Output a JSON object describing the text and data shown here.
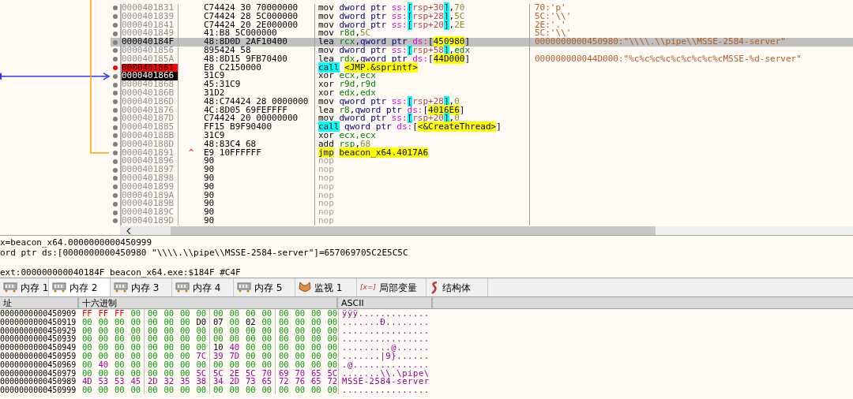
{
  "disasm": {
    "rows": [
      {
        "address": "0000401831",
        "bytes": "C74424 30 70000000",
        "breakpoint": false,
        "current": false,
        "selected": false,
        "comment": "70:'p'",
        "instruction": [
          {
            "text": "mov ",
            "kind": "op"
          },
          {
            "text": "dword ptr ",
            "kind": "ptr"
          },
          {
            "text": "ss:",
            "kind": "seg"
          },
          {
            "text": "[",
            "kind": "sbr"
          },
          {
            "text": "rsp+30",
            "kind": "mem"
          },
          {
            "text": "]",
            "kind": "sbr"
          },
          {
            "text": ",",
            "kind": "punct"
          },
          {
            "text": "70",
            "kind": "num"
          }
        ]
      },
      {
        "address": "0000401839",
        "bytes": "C74424 28 5C000000",
        "breakpoint": false,
        "current": false,
        "selected": false,
        "comment": "5C:'\\\\'",
        "instruction": [
          {
            "text": "mov ",
            "kind": "op"
          },
          {
            "text": "dword ptr ",
            "kind": "ptr"
          },
          {
            "text": "ss:",
            "kind": "seg"
          },
          {
            "text": "[",
            "kind": "sbr"
          },
          {
            "text": "rsp+28",
            "kind": "mem"
          },
          {
            "text": "]",
            "kind": "sbr"
          },
          {
            "text": ",",
            "kind": "punct"
          },
          {
            "text": "5C",
            "kind": "num"
          }
        ]
      },
      {
        "address": "0000401841",
        "bytes": "C74424 20 2E000000",
        "breakpoint": false,
        "current": false,
        "selected": false,
        "comment": "2E:'.'",
        "instruction": [
          {
            "text": "mov ",
            "kind": "op"
          },
          {
            "text": "dword ptr ",
            "kind": "ptr"
          },
          {
            "text": "ss:",
            "kind": "seg"
          },
          {
            "text": "[",
            "kind": "sbr"
          },
          {
            "text": "rsp+20",
            "kind": "mem"
          },
          {
            "text": "]",
            "kind": "sbr"
          },
          {
            "text": ",",
            "kind": "punct"
          },
          {
            "text": "2E",
            "kind": "num"
          }
        ]
      },
      {
        "address": "0000401849",
        "bytes": "41:B8 5C000000",
        "breakpoint": false,
        "current": false,
        "selected": false,
        "comment": "5C:'\\\\'",
        "instruction": [
          {
            "text": "mov ",
            "kind": "op"
          },
          {
            "text": "r8d",
            "kind": "reg"
          },
          {
            "text": ",",
            "kind": "punct"
          },
          {
            "text": "5C",
            "kind": "num"
          }
        ]
      },
      {
        "address": "000040184F",
        "bytes": "48:8D0D 2AF10400",
        "breakpoint": false,
        "current": false,
        "selected": true,
        "comment": "0000000000450980:\"\\\\\\\\.\\\\pipe\\\\MSSE-2584-server\"",
        "instruction": [
          {
            "text": "lea ",
            "kind": "op"
          },
          {
            "text": "rcx",
            "kind": "reg"
          },
          {
            "text": ",",
            "kind": "punct"
          },
          {
            "text": "qword ptr ",
            "kind": "ptr"
          },
          {
            "text": "ds:",
            "kind": "seg"
          },
          {
            "text": "[",
            "kind": "punct"
          },
          {
            "text": "450980",
            "kind": "addr"
          },
          {
            "text": "]",
            "kind": "punct"
          }
        ]
      },
      {
        "address": "0000401856",
        "bytes": "895424 58",
        "breakpoint": false,
        "current": false,
        "selected": false,
        "instruction": [
          {
            "text": "mov ",
            "kind": "op"
          },
          {
            "text": "dword ptr ",
            "kind": "ptr"
          },
          {
            "text": "ss:",
            "kind": "seg"
          },
          {
            "text": "[",
            "kind": "sbr"
          },
          {
            "text": "rsp+58",
            "kind": "mem"
          },
          {
            "text": "]",
            "kind": "sbr"
          },
          {
            "text": ",",
            "kind": "punct"
          },
          {
            "text": "edx",
            "kind": "reg"
          }
        ]
      },
      {
        "address": "000040185A",
        "bytes": "48:8D15 9FB70400",
        "breakpoint": false,
        "current": false,
        "selected": false,
        "comment": "000000000044D000:\"%c%c%c%c%c%c%c%c%cMSSE-%d-server\"",
        "instruction": [
          {
            "text": "lea ",
            "kind": "op"
          },
          {
            "text": "rdx",
            "kind": "reg"
          },
          {
            "text": ",",
            "kind": "punct"
          },
          {
            "text": "qword ptr ",
            "kind": "ptr"
          },
          {
            "text": "ds:",
            "kind": "seg"
          },
          {
            "text": "[",
            "kind": "punct"
          },
          {
            "text": "44D000",
            "kind": "addr"
          },
          {
            "text": "]",
            "kind": "punct"
          }
        ]
      },
      {
        "address": "0000401861",
        "bytes": "E8 C2150000",
        "breakpoint": true,
        "current": false,
        "selected": false,
        "instruction": [
          {
            "text": "call",
            "kind": "call"
          },
          {
            "text": "<JMP.&sprintf>",
            "kind": "addr"
          }
        ]
      },
      {
        "address": "0000401866",
        "bytes": "31C9",
        "breakpoint": false,
        "current": true,
        "selected": false,
        "instruction": [
          {
            "text": "xor ",
            "kind": "op"
          },
          {
            "text": "ecx,ecx",
            "kind": "reg"
          }
        ]
      },
      {
        "address": "0000401868",
        "bytes": "45:31C9",
        "breakpoint": false,
        "current": false,
        "selected": false,
        "instruction": [
          {
            "text": "xor ",
            "kind": "op"
          },
          {
            "text": "r9d,r9d",
            "kind": "reg"
          }
        ]
      },
      {
        "address": "000040186B",
        "bytes": "31D2",
        "breakpoint": false,
        "current": false,
        "selected": false,
        "instruction": [
          {
            "text": "xor ",
            "kind": "op"
          },
          {
            "text": "edx,edx",
            "kind": "reg"
          }
        ]
      },
      {
        "address": "000040186D",
        "bytes": "48:C74424 28 0000000",
        "breakpoint": false,
        "current": false,
        "selected": false,
        "instruction": [
          {
            "text": "mov ",
            "kind": "op"
          },
          {
            "text": "qword ptr ",
            "kind": "ptr"
          },
          {
            "text": "ss:",
            "kind": "seg"
          },
          {
            "text": "[",
            "kind": "sbr"
          },
          {
            "text": "rsp+28",
            "kind": "mem"
          },
          {
            "text": "]",
            "kind": "sbr"
          },
          {
            "text": ",",
            "kind": "punct"
          },
          {
            "text": "0",
            "kind": "num"
          }
        ]
      },
      {
        "address": "0000401876",
        "bytes": "4C:8D05 69FEFFFF",
        "breakpoint": false,
        "current": false,
        "selected": false,
        "instruction": [
          {
            "text": "lea ",
            "kind": "op"
          },
          {
            "text": "r8",
            "kind": "reg"
          },
          {
            "text": ",",
            "kind": "punct"
          },
          {
            "text": "qword ptr ",
            "kind": "ptr"
          },
          {
            "text": "ds:",
            "kind": "seg"
          },
          {
            "text": "[",
            "kind": "punct"
          },
          {
            "text": "4016E6",
            "kind": "addr"
          },
          {
            "text": "]",
            "kind": "punct"
          }
        ]
      },
      {
        "address": "000040187D",
        "bytes": "C74424 20 00000000",
        "breakpoint": false,
        "current": false,
        "selected": false,
        "instruction": [
          {
            "text": "mov ",
            "kind": "op"
          },
          {
            "text": "dword ptr ",
            "kind": "ptr"
          },
          {
            "text": "ss:",
            "kind": "seg"
          },
          {
            "text": "[",
            "kind": "sbr"
          },
          {
            "text": "rsp+20",
            "kind": "mem"
          },
          {
            "text": "]",
            "kind": "sbr"
          },
          {
            "text": ",",
            "kind": "punct"
          },
          {
            "text": "0",
            "kind": "num"
          }
        ]
      },
      {
        "address": "0000401885",
        "bytes": "FF15 B9F90400",
        "breakpoint": false,
        "current": false,
        "selected": false,
        "instruction": [
          {
            "text": "call",
            "kind": "call"
          },
          {
            "text": "qword ptr ",
            "kind": "ptr"
          },
          {
            "text": "ds:",
            "kind": "seg"
          },
          {
            "text": "[",
            "kind": "punct"
          },
          {
            "text": "<&CreateThread>",
            "kind": "addr"
          },
          {
            "text": "]",
            "kind": "punct"
          }
        ]
      },
      {
        "address": "000040188B",
        "bytes": "31C9",
        "breakpoint": false,
        "current": false,
        "selected": false,
        "instruction": [
          {
            "text": "xor ",
            "kind": "op"
          },
          {
            "text": "ecx,ecx",
            "kind": "reg"
          }
        ]
      },
      {
        "address": "000040188D",
        "bytes": "48:83C4 68",
        "breakpoint": false,
        "current": false,
        "selected": false,
        "instruction": [
          {
            "text": "add ",
            "kind": "op"
          },
          {
            "text": "rsp",
            "kind": "reg"
          },
          {
            "text": ",",
            "kind": "punct"
          },
          {
            "text": "68",
            "kind": "num"
          }
        ]
      },
      {
        "address": "0000401891",
        "bytes": "E9 10FFFFFF",
        "marker": "^",
        "breakpoint": false,
        "current": false,
        "selected": false,
        "instruction": [
          {
            "text": "jmp",
            "kind": "jmp"
          },
          {
            "text": "beacon_x64.4017A6",
            "kind": "addr"
          }
        ]
      },
      {
        "address": "0000401896",
        "bytes": "90",
        "breakpoint": false,
        "current": false,
        "selected": false,
        "instruction": [
          {
            "text": "nop",
            "kind": "nop"
          }
        ]
      },
      {
        "address": "0000401897",
        "bytes": "90",
        "breakpoint": false,
        "current": false,
        "selected": false,
        "instruction": [
          {
            "text": "nop",
            "kind": "nop"
          }
        ]
      },
      {
        "address": "0000401898",
        "bytes": "90",
        "breakpoint": false,
        "current": false,
        "selected": false,
        "instruction": [
          {
            "text": "nop",
            "kind": "nop"
          }
        ]
      },
      {
        "address": "0000401899",
        "bytes": "90",
        "breakpoint": false,
        "current": false,
        "selected": false,
        "instruction": [
          {
            "text": "nop",
            "kind": "nop"
          }
        ]
      },
      {
        "address": "000040189A",
        "bytes": "90",
        "breakpoint": false,
        "current": false,
        "selected": false,
        "instruction": [
          {
            "text": "nop",
            "kind": "nop"
          }
        ]
      },
      {
        "address": "000040189B",
        "bytes": "90",
        "breakpoint": false,
        "current": false,
        "selected": false,
        "instruction": [
          {
            "text": "nop",
            "kind": "nop"
          }
        ]
      },
      {
        "address": "000040189C",
        "bytes": "90",
        "breakpoint": false,
        "current": false,
        "selected": false,
        "instruction": [
          {
            "text": "nop",
            "kind": "nop"
          }
        ]
      },
      {
        "address": "000040189D",
        "bytes": "90",
        "breakpoint": false,
        "current": false,
        "selected": false,
        "instruction": [
          {
            "text": "nop",
            "kind": "nop"
          }
        ]
      }
    ]
  },
  "info": {
    "lines": [
      "x=beacon_x64.0000000000450999",
      "ord ptr ds:[0000000000450980 \"\\\\\\\\.\\\\pipe\\\\MSSE-2584-server\"]=657069705C2E5C5C"
    ],
    "location": "ext:000000000040184F beacon_x64.exe:$184F #C4F"
  },
  "tabs": [
    {
      "label": "内存 1",
      "kind": "memory",
      "selected": false
    },
    {
      "label": "内存 2",
      "kind": "memory",
      "selected": true
    },
    {
      "label": "内存 3",
      "kind": "memory",
      "selected": false
    },
    {
      "label": "内存 4",
      "kind": "memory",
      "selected": false
    },
    {
      "label": "内存 5",
      "kind": "memory",
      "selected": false
    },
    {
      "label": "监视 1",
      "kind": "watch",
      "selected": false
    },
    {
      "label": "局部变量",
      "kind": "locals",
      "icon_text": "[x=]",
      "selected": false
    },
    {
      "label": "结构体",
      "kind": "struct",
      "selected": false
    }
  ],
  "dump": {
    "columns": [
      "址",
      "十六进制",
      "ASCII"
    ],
    "rows": [
      {
        "address": "0000000000450909",
        "bytes": [
          "FF",
          "FF",
          "FF",
          "00",
          "00",
          "00",
          "00",
          "00",
          "00",
          "00",
          "00",
          "00",
          "00",
          "00",
          "00",
          "00"
        ],
        "ascii": "ÿÿÿ............."
      },
      {
        "address": "0000000000450919",
        "bytes": [
          "00",
          "00",
          "00",
          "00",
          "00",
          "00",
          "00",
          "D0",
          "07",
          "00",
          "02",
          "00",
          "00",
          "00",
          "00",
          "00"
        ],
        "ascii": ".......Ð........"
      },
      {
        "address": "0000000000450929",
        "bytes": [
          "00",
          "00",
          "00",
          "00",
          "00",
          "00",
          "00",
          "00",
          "00",
          "00",
          "00",
          "00",
          "00",
          "00",
          "00",
          "00"
        ],
        "ascii": "................"
      },
      {
        "address": "0000000000450939",
        "bytes": [
          "00",
          "00",
          "00",
          "00",
          "00",
          "00",
          "00",
          "00",
          "00",
          "00",
          "00",
          "00",
          "00",
          "00",
          "00",
          "00"
        ],
        "ascii": "................"
      },
      {
        "address": "0000000000450949",
        "bytes": [
          "00",
          "00",
          "00",
          "00",
          "00",
          "00",
          "00",
          "00",
          "10",
          "40",
          "00",
          "00",
          "00",
          "00",
          "00",
          "00"
        ],
        "ascii": ".........@......"
      },
      {
        "address": "0000000000450959",
        "bytes": [
          "00",
          "00",
          "00",
          "00",
          "00",
          "00",
          "00",
          "7C",
          "39",
          "7D",
          "00",
          "00",
          "00",
          "00",
          "00",
          "00"
        ],
        "ascii": ".......|9}......"
      },
      {
        "address": "0000000000450969",
        "bytes": [
          "00",
          "40",
          "00",
          "00",
          "00",
          "00",
          "00",
          "00",
          "00",
          "00",
          "00",
          "00",
          "00",
          "00",
          "00",
          "00"
        ],
        "ascii": ".@.............."
      },
      {
        "address": "0000000000450979",
        "bytes": [
          "00",
          "00",
          "00",
          "00",
          "00",
          "00",
          "00",
          "5C",
          "5C",
          "2E",
          "5C",
          "70",
          "69",
          "70",
          "65",
          "5C"
        ],
        "ascii": ".......\\\\.\\pipe\\"
      },
      {
        "address": "0000000000450989",
        "bytes": [
          "4D",
          "53",
          "53",
          "45",
          "2D",
          "32",
          "35",
          "38",
          "34",
          "2D",
          "73",
          "65",
          "72",
          "76",
          "65",
          "72"
        ],
        "ascii": "MSSE-2584-server"
      },
      {
        "address": "0000000000450999",
        "bytes": [
          "00",
          "00",
          "00",
          "00",
          "00",
          "00",
          "00",
          "00",
          "00",
          "00",
          "00",
          "00",
          "00",
          "00",
          "00",
          "00"
        ],
        "ascii": "................"
      }
    ]
  }
}
